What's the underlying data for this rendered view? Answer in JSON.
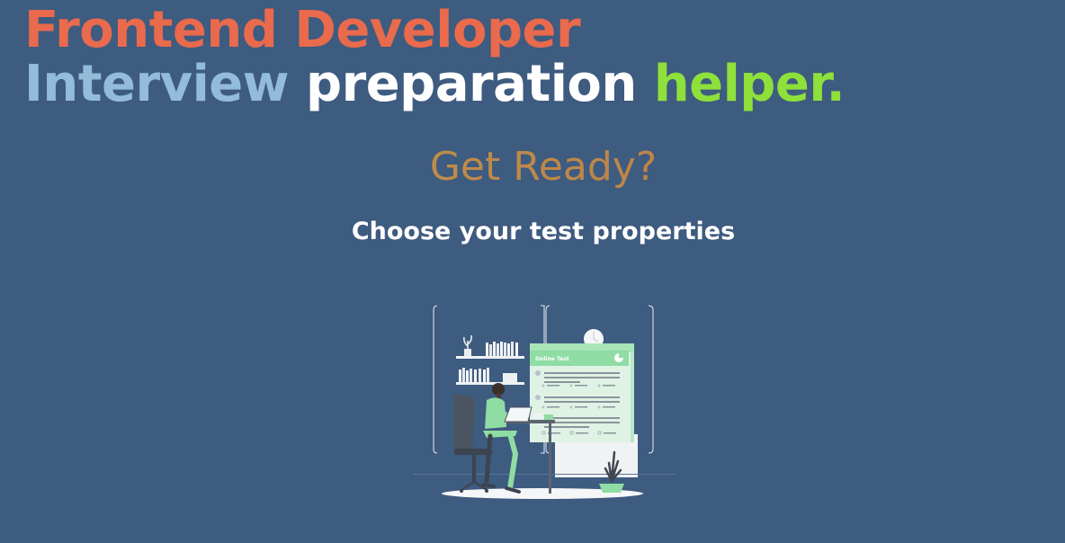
{
  "hero": {
    "line1": "Frontend Developer",
    "line2": {
      "word1": "Interview",
      "word2": "preparation",
      "word3": "helper."
    }
  },
  "get_ready": "Get Ready?",
  "subtitle": "Choose your test properties",
  "illustration": {
    "card_title": "Online Test",
    "icons": [
      "person-at-desk-icon",
      "online-test-card-icon",
      "plant-icon",
      "bookshelf-icon",
      "clock-icon"
    ]
  },
  "colors": {
    "background": "#3e5b80",
    "line1": "#e96a4c",
    "interview": "#93bcd9",
    "preparation": "#ffffff",
    "helper": "#8ee03a",
    "get_ready": "#c1864a",
    "accent_green": "#94e0a8"
  }
}
